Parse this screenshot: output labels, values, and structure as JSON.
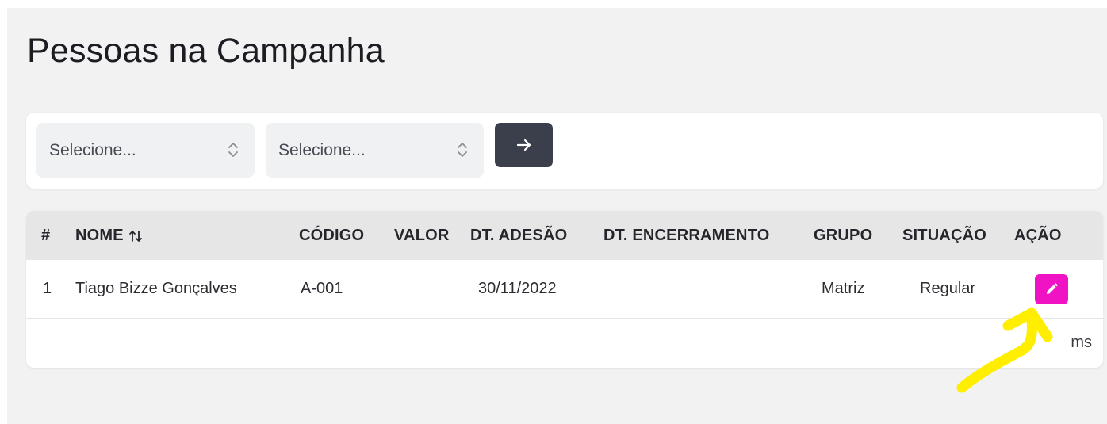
{
  "page": {
    "title": "Pessoas na Campanha"
  },
  "filters": {
    "select1": {
      "value": "Selecione...",
      "icon": "chevron-updown-icon"
    },
    "select2": {
      "value": "Selecione...",
      "icon": "chevron-updown-icon"
    },
    "submit": {
      "icon": "arrow-right-icon"
    }
  },
  "table": {
    "headers": [
      "#",
      "NOME",
      "CÓDIGO",
      "VALOR",
      "DT. ADESÃO",
      "DT. ENCERRAMENTO",
      "GRUPO",
      "SITUAÇÃO",
      "AÇÃO"
    ],
    "sort_icon": "sort-arrows-icon",
    "rows": [
      {
        "index": "1",
        "nome": "Tiago Bizze Gonçalves",
        "codigo": "A-001",
        "valor": "",
        "dt_adesao": "30/11/2022",
        "dt_encerramento": "",
        "grupo": "Matriz",
        "situacao": "Regular",
        "acao_icon": "pencil-icon"
      }
    ],
    "footer_text": "ms"
  },
  "colors": {
    "page_bg": "#f2f2f3",
    "card_bg": "#ffffff",
    "header_bg": "#e6e6e6",
    "button_dark": "#3a3f4b",
    "edit_button": "#f013c4",
    "annotation_arrow": "#ffee00"
  }
}
